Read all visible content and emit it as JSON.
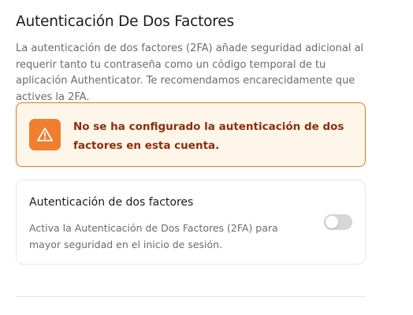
{
  "section": {
    "title": "Autenticación De Dos Factores",
    "description": "La autenticación de dos factores (2FA) añade seguridad adicional al requerir tanto tu contraseña como un código temporal de tu aplicación Authenticator. Te recomendamos encarecidamente que actives la 2FA."
  },
  "alert": {
    "icon": "warning-triangle-icon",
    "message": "No se ha configurado la autenticación de dos factores en esta cuenta.",
    "background_color": "#fff6ea",
    "border_color": "#d9782c",
    "icon_color": "#f07e2c",
    "text_color": "#8a2e0f"
  },
  "two_factor_card": {
    "title": "Autenticación de dos factores",
    "description": "Activa la Autenticación de Dos Factores (2FA) para mayor seguridad en el inicio de sesión.",
    "toggle_enabled": false
  }
}
